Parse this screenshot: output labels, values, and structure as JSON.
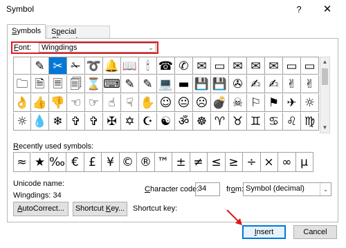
{
  "window": {
    "title": "Symbol",
    "help": "?",
    "close": "✕"
  },
  "tabs": [
    {
      "label_first": "S",
      "label_rest": "ymbols"
    },
    {
      "label_pre": "S",
      "label_u": "p",
      "label_rest": "ecial Characters"
    }
  ],
  "font": {
    "label_u": "F",
    "label_rest": "ont:",
    "value": "Wingdings",
    "arrow": "⌄"
  },
  "symbols": [
    [
      " ",
      "✎",
      "✂",
      "✁",
      "➰",
      "🔔",
      "📖",
      "🕯",
      "☎",
      "✆",
      "✉",
      "▭",
      "✉",
      "✉",
      "✉",
      "▭"
    ],
    [
      "🗀",
      "🗎",
      "🗏",
      "🗐",
      "⌛",
      "⌨",
      "✎",
      "✎",
      "💻",
      "▬",
      "💾",
      "💾",
      "✇",
      "✍",
      "✍",
      "✌"
    ],
    [
      "👌",
      "👍",
      "👎",
      "☜",
      "☞",
      "☝",
      "☟",
      "✋",
      "☺",
      "😐",
      "☹",
      "💣",
      "☠",
      "⚐",
      "⚑",
      "✈"
    ],
    [
      "☼",
      "💧",
      "❄",
      "✞",
      "✞",
      "✠",
      "✡",
      "☪",
      "☯",
      "ॐ",
      "☸",
      "♈",
      "♉",
      "♊",
      "♋",
      "♌"
    ]
  ],
  "symbols_last_col": [
    "▭",
    "✌",
    "☼",
    "♍"
  ],
  "recent": {
    "label_u": "R",
    "label_rest": "ecently used symbols:",
    "items": [
      "≈",
      "★",
      "‰",
      "€",
      "£",
      "¥",
      "©",
      "®",
      "™",
      "±",
      "≠",
      "≤",
      "≥",
      "÷",
      "×",
      "∞",
      "µ"
    ]
  },
  "unicode": {
    "name_label": "Unicode name:",
    "name_value": "Wingdings: 34"
  },
  "char_code": {
    "label_u": "C",
    "label_rest": "haracter code:",
    "value": "34"
  },
  "from": {
    "label_pre": "fr",
    "label_u": "o",
    "label_rest": "m:",
    "value": "Symbol (decimal)",
    "arrow": "⌄"
  },
  "buttons": {
    "autocorrect_u": "A",
    "autocorrect_rest": "utoCorrect...",
    "shortcut_pre": "Shortcut ",
    "shortcut_u": "K",
    "shortcut_rest": "ey...",
    "shortcut_key_label": "Shortcut key:",
    "insert_u": "I",
    "insert_rest": "nsert",
    "cancel": "Cancel"
  },
  "accent": {
    "selected": "#0078d7",
    "highlight": "#e0151b"
  }
}
